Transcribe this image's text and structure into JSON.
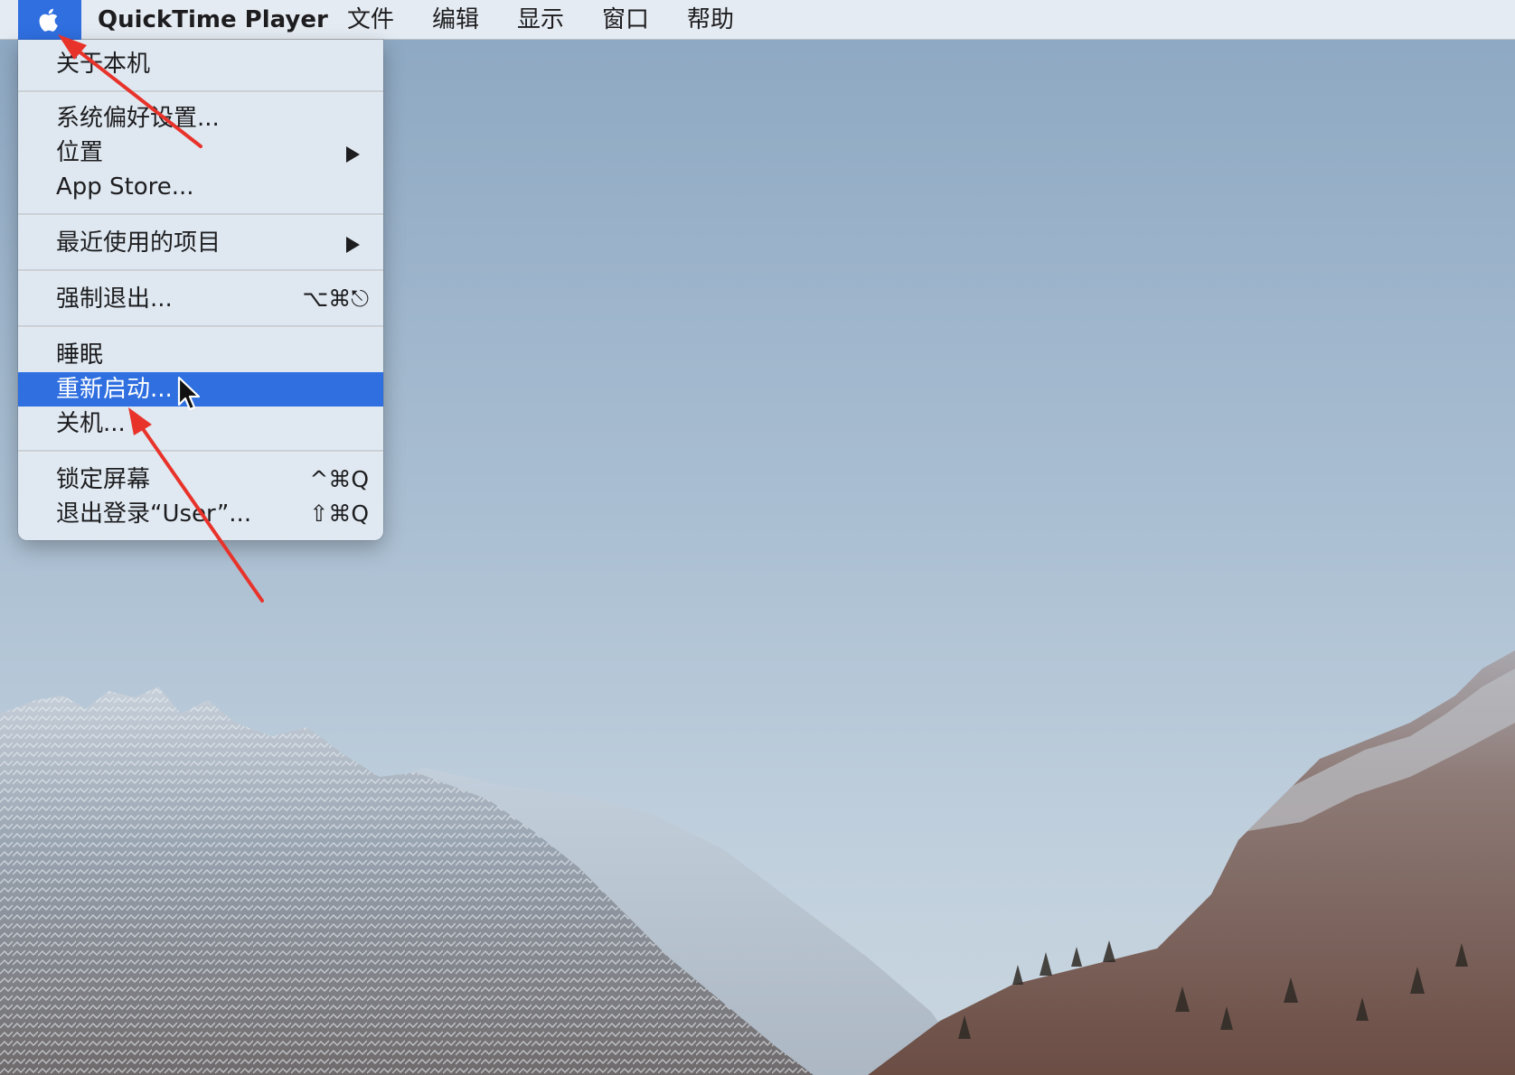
{
  "menubar": {
    "apple_icon": "apple-logo-icon",
    "app_name": "QuickTime Player",
    "items": [
      {
        "label": "文件"
      },
      {
        "label": "编辑"
      },
      {
        "label": "显示"
      },
      {
        "label": "窗口"
      },
      {
        "label": "帮助"
      }
    ]
  },
  "apple_menu": {
    "about": "关于本机",
    "system_prefs": "系统偏好设置...",
    "location": "位置",
    "app_store": "App Store...",
    "recent_items": "最近使用的项目",
    "force_quit": "强制退出...",
    "force_quit_shortcut": "⌥⌘⎋",
    "sleep": "睡眠",
    "restart": "重新启动...",
    "shutdown": "关机...",
    "lock_screen": "锁定屏幕",
    "lock_screen_shortcut": "^⌘Q",
    "logout": "退出登录“User”...",
    "logout_shortcut": "⇧⌘Q"
  },
  "highlighted_item": "重新启动...",
  "colors": {
    "accent": "#2f6fe0",
    "annotation_arrow": "#e8332b",
    "menu_background": "#e2eaf3"
  },
  "icons": [
    "apple-logo-icon",
    "submenu-arrow-icon",
    "mouse-pointer-icon",
    "annotation-arrow"
  ]
}
